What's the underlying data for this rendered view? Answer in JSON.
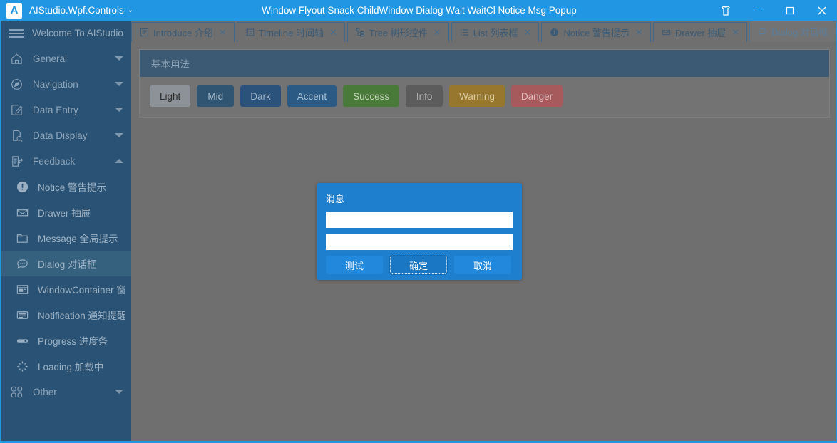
{
  "titlebar": {
    "logo_letter": "A",
    "app_name": "AIStudio.Wpf.Controls",
    "app_name_caret": "⌄",
    "center_title": "Window Flyout Snack ChildWindow Dialog Wait WaitCl Notice Msg Popup",
    "theme_icon": "tshirt-icon",
    "minimize_label": "–",
    "maximize_label": "□",
    "close_label": "✕",
    "accent_color": "#2196e3"
  },
  "sidebar": {
    "menu_icon": "hamburger-icon",
    "header_label": "Welcome To AIStudio",
    "background_color": "#2a5274",
    "active_color": "#35617f",
    "groups": [
      {
        "label": "General",
        "icon": "home-icon",
        "expanded": false
      },
      {
        "label": "Navigation",
        "icon": "compass-icon",
        "expanded": false
      },
      {
        "label": "Data Entry",
        "icon": "edit-box-icon",
        "expanded": false
      },
      {
        "label": "Data Display",
        "icon": "file-search-icon",
        "expanded": false
      },
      {
        "label": "Feedback",
        "icon": "form-edit-icon",
        "expanded": true
      }
    ],
    "items": [
      {
        "label": "Notice 警告提示",
        "icon": "exclamation-circle-icon",
        "active": false
      },
      {
        "label": "Drawer 抽屉",
        "icon": "inbox-icon",
        "active": false
      },
      {
        "label": "Message 全局提示",
        "icon": "folder-icon",
        "active": false
      },
      {
        "label": "Dialog 对话框",
        "icon": "chat-bubble-icon",
        "active": true
      },
      {
        "label": "WindowContainer 窗",
        "icon": "window-icon",
        "active": false
      },
      {
        "label": "Notification 通知提醒",
        "icon": "lines-icon",
        "active": false
      },
      {
        "label": "Progress 进度条",
        "icon": "progress-pill-icon",
        "active": false
      },
      {
        "label": "Loading 加载中",
        "icon": "spinner-icon",
        "active": false
      }
    ],
    "footer_group": {
      "label": "Other",
      "icon": "grid-squares-icon",
      "expanded": false
    }
  },
  "tabs": {
    "items": [
      {
        "label": "Introduce 介绍",
        "icon": "book-icon",
        "close": "✕",
        "selected": false
      },
      {
        "label": "Timeline 时间轴",
        "icon": "timeline-icon",
        "close": "✕",
        "selected": false
      },
      {
        "label": "Tree 树形控件",
        "icon": "tree-icon",
        "close": "✕",
        "selected": false
      },
      {
        "label": "List 列表框",
        "icon": "list-icon",
        "close": "✕",
        "selected": false
      },
      {
        "label": "Notice 警告提示",
        "icon": "exclamation-circle-icon",
        "close": "✕",
        "selected": false
      },
      {
        "label": "Drawer 抽屉",
        "icon": "envelope-icon",
        "close": "✕",
        "selected": false
      },
      {
        "label": "Dialog 对话框",
        "icon": "chat-bubble-icon",
        "close": "✕",
        "selected": true
      }
    ],
    "overflow_icon": "chevron-down-icon"
  },
  "main": {
    "card_title": "基本用法",
    "buttons": [
      {
        "label": "Light",
        "bg": "#8d9298",
        "fg": "#2b2b2b"
      },
      {
        "label": "Mid",
        "bg": "#2f5573",
        "fg": "#a8bccd"
      },
      {
        "label": "Dark",
        "bg": "#2a527a",
        "fg": "#9db4c8"
      },
      {
        "label": "Accent",
        "bg": "#2b5a84",
        "fg": "#a7c2d6"
      },
      {
        "label": "Success",
        "bg": "#4a7a3a",
        "fg": "#c1d4b8"
      },
      {
        "label": "Info",
        "bg": "#5c5c5c",
        "fg": "#b5b5b5"
      },
      {
        "label": "Warning",
        "bg": "#97772e",
        "fg": "#ddcba3"
      },
      {
        "label": "Danger",
        "bg": "#a65a5c",
        "fg": "#e0bdbe"
      }
    ]
  },
  "dialog": {
    "title": "消息",
    "background_color": "#1f7fcf",
    "input_one_value": "",
    "input_one_placeholder": "",
    "input_two_value": "",
    "input_two_placeholder": "",
    "buttons": [
      {
        "label": "测试",
        "focused": false
      },
      {
        "label": "确定",
        "focused": true
      },
      {
        "label": "取消",
        "focused": false
      }
    ]
  }
}
